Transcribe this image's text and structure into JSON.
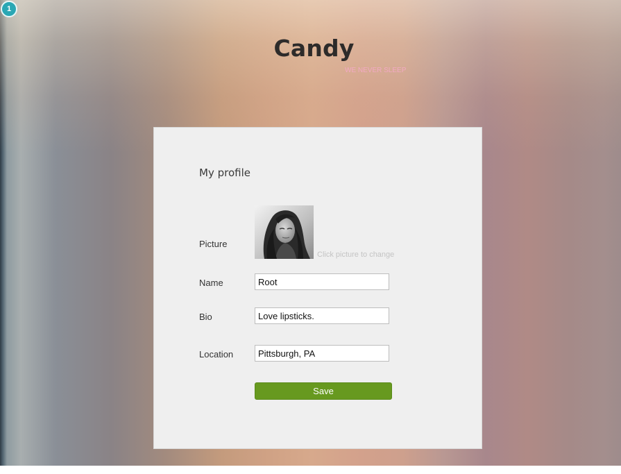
{
  "header": {
    "site_title": "Candy",
    "site_link": "WE NEVER SLEEP"
  },
  "step_badge": "1",
  "profile": {
    "title": "My profile",
    "picture_label": "Picture",
    "picture_hint": "Click picture to change",
    "name_label": "Name",
    "name_value": "Root",
    "bio_label": "Bio",
    "bio_value": "Love lipsticks.",
    "location_label": "Location",
    "location_value": "Pittsburgh, PA",
    "save_label": "Save"
  },
  "colors": {
    "save_button": "#67991f",
    "panel_background": "#efefef",
    "title_text": "#2d2b2a",
    "site_link": "#f3a9c4",
    "badge": "#2aa7b4"
  },
  "icons": {
    "step_badge": "numbered-circle-icon",
    "profile_picture": "user-portrait-photo"
  }
}
